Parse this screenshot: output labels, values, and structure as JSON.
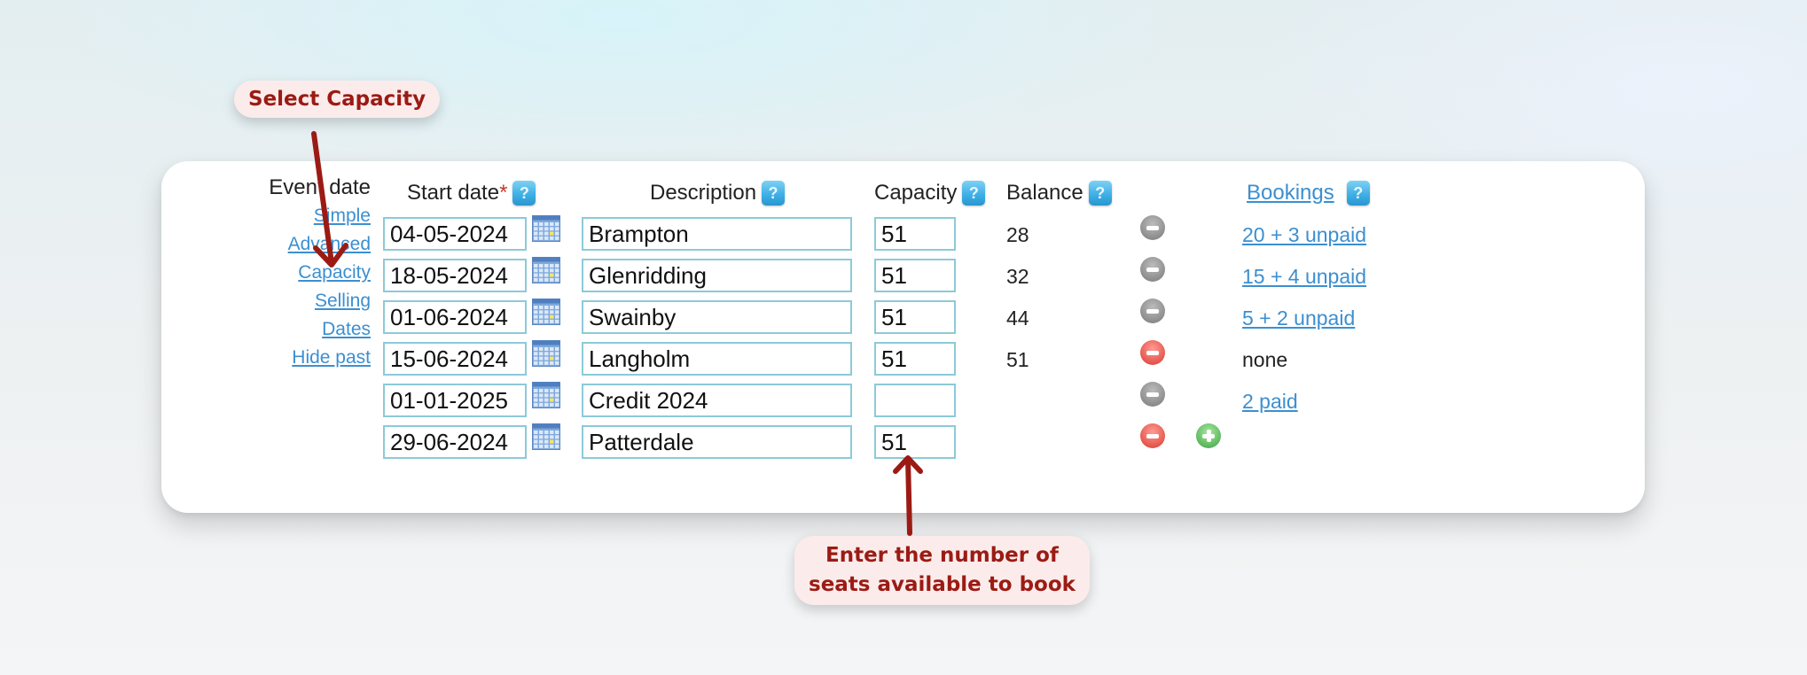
{
  "annotations": {
    "select_capacity": "Select Capacity",
    "enter_seats_line1": "Enter the number of",
    "enter_seats_line2": "seats available to book",
    "color": "#9b1b14"
  },
  "sidebar": {
    "title": "Event date",
    "links": [
      {
        "label": "Simple"
      },
      {
        "label": "Advanced"
      },
      {
        "label": "Capacity"
      },
      {
        "label": "Selling"
      },
      {
        "label": "Dates"
      },
      {
        "label": "Hide past"
      }
    ]
  },
  "headers": {
    "start_date": "Start date",
    "required_mark": "*",
    "description": "Description",
    "capacity": "Capacity",
    "balance": "Balance",
    "bookings": "Bookings",
    "help_glyph": "?"
  },
  "icons": {
    "help": "help-icon",
    "calendar": "calendar-icon",
    "remove": "minus-circle-icon",
    "add": "plus-circle-icon"
  },
  "rows": [
    {
      "start_date": "04-05-2024",
      "description": "Brampton",
      "capacity": "51",
      "balance": "28",
      "remove_state": "disabled",
      "bookings": "20 + 3 unpaid",
      "bookings_link": true
    },
    {
      "start_date": "18-05-2024",
      "description": "Glenridding",
      "capacity": "51",
      "balance": "32",
      "remove_state": "disabled",
      "bookings": "15 + 4 unpaid",
      "bookings_link": true
    },
    {
      "start_date": "01-06-2024",
      "description": "Swainby",
      "capacity": "51",
      "balance": "44",
      "remove_state": "disabled",
      "bookings": "5 + 2 unpaid",
      "bookings_link": true
    },
    {
      "start_date": "15-06-2024",
      "description": "Langholm",
      "capacity": "51",
      "balance": "51",
      "remove_state": "active",
      "bookings": "none",
      "bookings_link": false
    },
    {
      "start_date": "01-01-2025",
      "description": "Credit 2024",
      "capacity": "",
      "balance": "",
      "remove_state": "disabled",
      "bookings": "2 paid",
      "bookings_link": true
    },
    {
      "start_date": "29-06-2024",
      "description": "Patterdale",
      "capacity": "51",
      "balance": "",
      "remove_state": "active",
      "bookings": "",
      "bookings_link": false,
      "add_row": true
    }
  ],
  "colors": {
    "link": "#3c8fd0",
    "field_border": "#8ccad8",
    "remove_active": "#e4574d",
    "remove_disabled": "#8d8d8d",
    "add": "#5cb85c"
  }
}
